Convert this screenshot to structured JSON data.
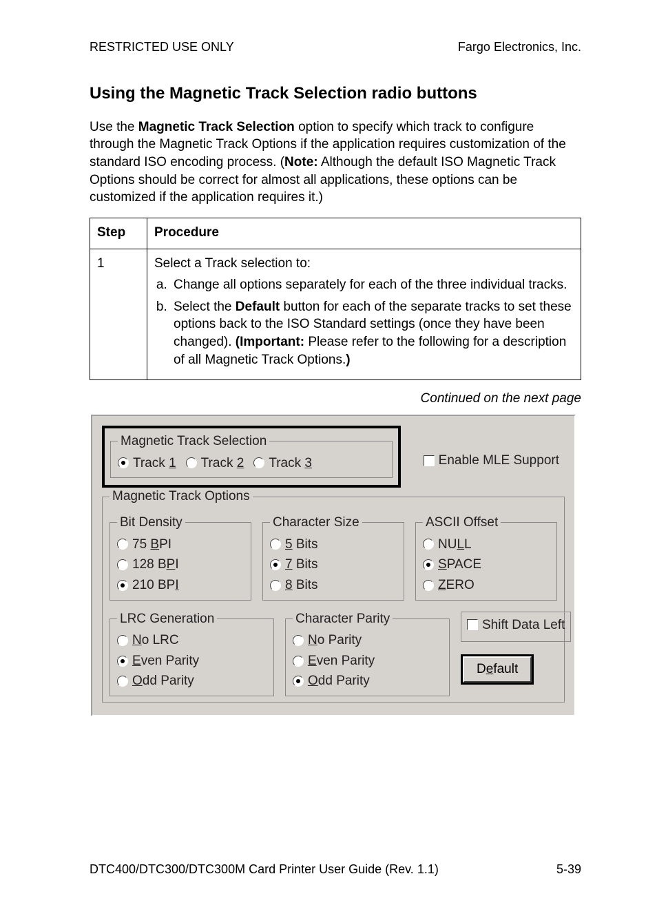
{
  "header": {
    "left": "RESTRICTED USE ONLY",
    "right": "Fargo Electronics, Inc."
  },
  "title": "Using the Magnetic Track Selection radio buttons",
  "intro": {
    "pre": "Use the ",
    "b1": "Magnetic Track Selection",
    "mid1": " option to specify which track to configure through the Magnetic Track Options if the application requires customization of the standard ISO encoding process. (",
    "b2": "Note:",
    "mid2": "  Although the default ISO Magnetic Track Options should be correct for almost all applications, these options can be customized if the application requires it.)"
  },
  "table": {
    "h1": "Step",
    "h2": "Procedure",
    "step": "1",
    "lead": "Select a Track selection to:",
    "a": "Change all options separately for each of the three individual tracks.",
    "b_pre": "Select the ",
    "b_bold1": "Default",
    "b_mid1": " button for each of the separate tracks to set these options back to the ISO Standard settings (once they have been changed). ",
    "b_open": "(",
    "b_bold2": "Important:",
    "b_mid2": "  Please refer to the following for a description of all Magnetic Track Options.",
    "b_close": ")"
  },
  "continued": "Continued on the next page",
  "dialog": {
    "mag_sel_legend": "Magnetic Track Selection",
    "track1_pre": "Track ",
    "track1_u": "1",
    "track2_pre": "Track ",
    "track2_u": "2",
    "track3_pre": "Track ",
    "track3_u": "3",
    "mle": "Enable MLE Support",
    "mag_opts_legend": "Magnetic Track Options",
    "bit_density_legend": "Bit Density",
    "bd75_pre": "  75 ",
    "bd75_u": "B",
    "bd75_post": "PI",
    "bd128_pre": "128 B",
    "bd128_u": "P",
    "bd128_post": "I",
    "bd210_pre": "210 BP",
    "bd210_u": "I",
    "bd210_post": "",
    "char_size_legend": "Character Size",
    "cs5_u": "5",
    "cs5_post": " Bits",
    "cs7_u": "7",
    "cs7_post": " Bits",
    "cs8_u": "8",
    "cs8_post": " Bits",
    "ascii_legend": "ASCII Offset",
    "ao_null_pre": "NU",
    "ao_null_u": "L",
    "ao_null_post": "L",
    "ao_space_u": "S",
    "ao_space_post": "PACE",
    "ao_zero_u": "Z",
    "ao_zero_post": "ERO",
    "lrc_legend": "LRC Generation",
    "lrc_no_u": "N",
    "lrc_no_post": "o LRC",
    "lrc_even_u": "E",
    "lrc_even_post": "ven Parity",
    "lrc_odd_u": "O",
    "lrc_odd_post": "dd Parity",
    "cp_legend": "Character Parity",
    "cp_no_u": "N",
    "cp_no_post": "o Parity",
    "cp_even_u": "E",
    "cp_even_post": "ven Parity",
    "cp_odd_u": "O",
    "cp_odd_post": "dd Parity",
    "shift": "Shift Data Left",
    "default_pre": "D",
    "default_u": "e",
    "default_post": "fault"
  },
  "footer": {
    "left": "DTC400/DTC300/DTC300M Card Printer User Guide (Rev. 1.1)",
    "right": "5-39"
  }
}
